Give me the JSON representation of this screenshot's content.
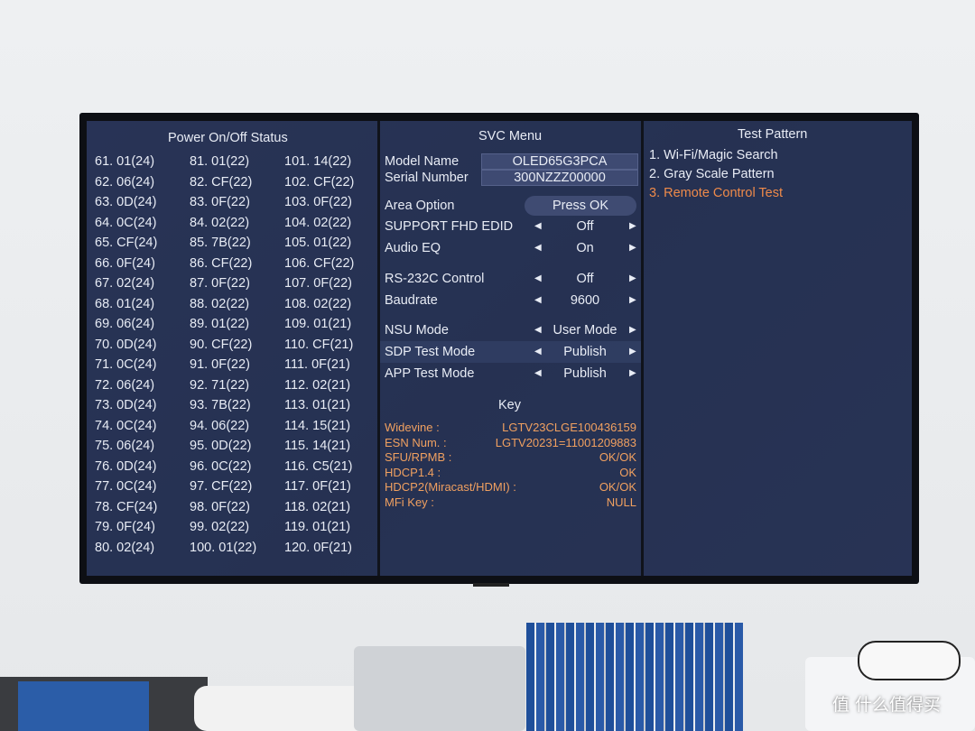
{
  "power_status": {
    "title": "Power On/Off Status",
    "columns": [
      [
        "61. 01(24)",
        "62. 06(24)",
        "63. 0D(24)",
        "64. 0C(24)",
        "65. CF(24)",
        "66. 0F(24)",
        "67. 02(24)",
        "68. 01(24)",
        "69. 06(24)",
        "70. 0D(24)",
        "71. 0C(24)",
        "72. 06(24)",
        "73. 0D(24)",
        "74. 0C(24)",
        "75. 06(24)",
        "76. 0D(24)",
        "77. 0C(24)",
        "78. CF(24)",
        "79. 0F(24)",
        "80. 02(24)"
      ],
      [
        "81. 01(22)",
        "82. CF(22)",
        "83. 0F(22)",
        "84. 02(22)",
        "85. 7B(22)",
        "86. CF(22)",
        "87. 0F(22)",
        "88. 02(22)",
        "89. 01(22)",
        "90. CF(22)",
        "91. 0F(22)",
        "92. 71(22)",
        "93. 7B(22)",
        "94. 06(22)",
        "95. 0D(22)",
        "96. 0C(22)",
        "97. CF(22)",
        "98. 0F(22)",
        "99. 02(22)",
        "100. 01(22)"
      ],
      [
        "101. 14(22)",
        "102. CF(22)",
        "103. 0F(22)",
        "104. 02(22)",
        "105. 01(22)",
        "106. CF(22)",
        "107. 0F(22)",
        "108. 02(22)",
        "109. 01(21)",
        "110. CF(21)",
        "111. 0F(21)",
        "112. 02(21)",
        "113. 01(21)",
        "114. 15(21)",
        "115. 14(21)",
        "116. C5(21)",
        "117. 0F(21)",
        "118. 02(21)",
        "119. 01(21)",
        "120. 0F(21)"
      ]
    ]
  },
  "svc_menu": {
    "title": "SVC Menu",
    "model_name_label": "Model Name",
    "model_name": "OLED65G3PCA",
    "serial_label": "Serial Number",
    "serial": "300NZZZ00000",
    "area_option_label": "Area Option",
    "area_option_button": "Press OK",
    "settings": [
      {
        "label": "SUPPORT FHD EDID",
        "value": "Off"
      },
      {
        "label": "Audio EQ",
        "value": "On"
      },
      {
        "label": "RS-232C Control",
        "value": "Off"
      },
      {
        "label": "Baudrate",
        "value": "9600"
      },
      {
        "label": "NSU Mode",
        "value": "User Mode"
      },
      {
        "label": "SDP Test Mode",
        "value": "Publish"
      },
      {
        "label": "APP Test Mode",
        "value": "Publish"
      }
    ],
    "key_title": "Key",
    "keys": [
      {
        "label": "Widevine :",
        "value": "LGTV23CLGE100436159"
      },
      {
        "label": "ESN Num. :",
        "value": "LGTV20231=11001209883"
      },
      {
        "label": "SFU/RPMB :",
        "value": "OK/OK"
      },
      {
        "label": "HDCP1.4 :",
        "value": "OK"
      },
      {
        "label": "HDCP2(Miracast/HDMI) :",
        "value": "OK/OK"
      },
      {
        "label": "MFi Key :",
        "value": "NULL"
      }
    ]
  },
  "test_pattern": {
    "title": "Test Pattern",
    "items": [
      "1. Wi-Fi/Magic Search",
      "2. Gray Scale Pattern",
      "3. Remote Control Test"
    ],
    "selected_index": 2
  },
  "watermark": "什么值得买",
  "colors": {
    "screen": "#2a3659",
    "accent": "#ee8a4a",
    "text": "#e8ecf5"
  }
}
